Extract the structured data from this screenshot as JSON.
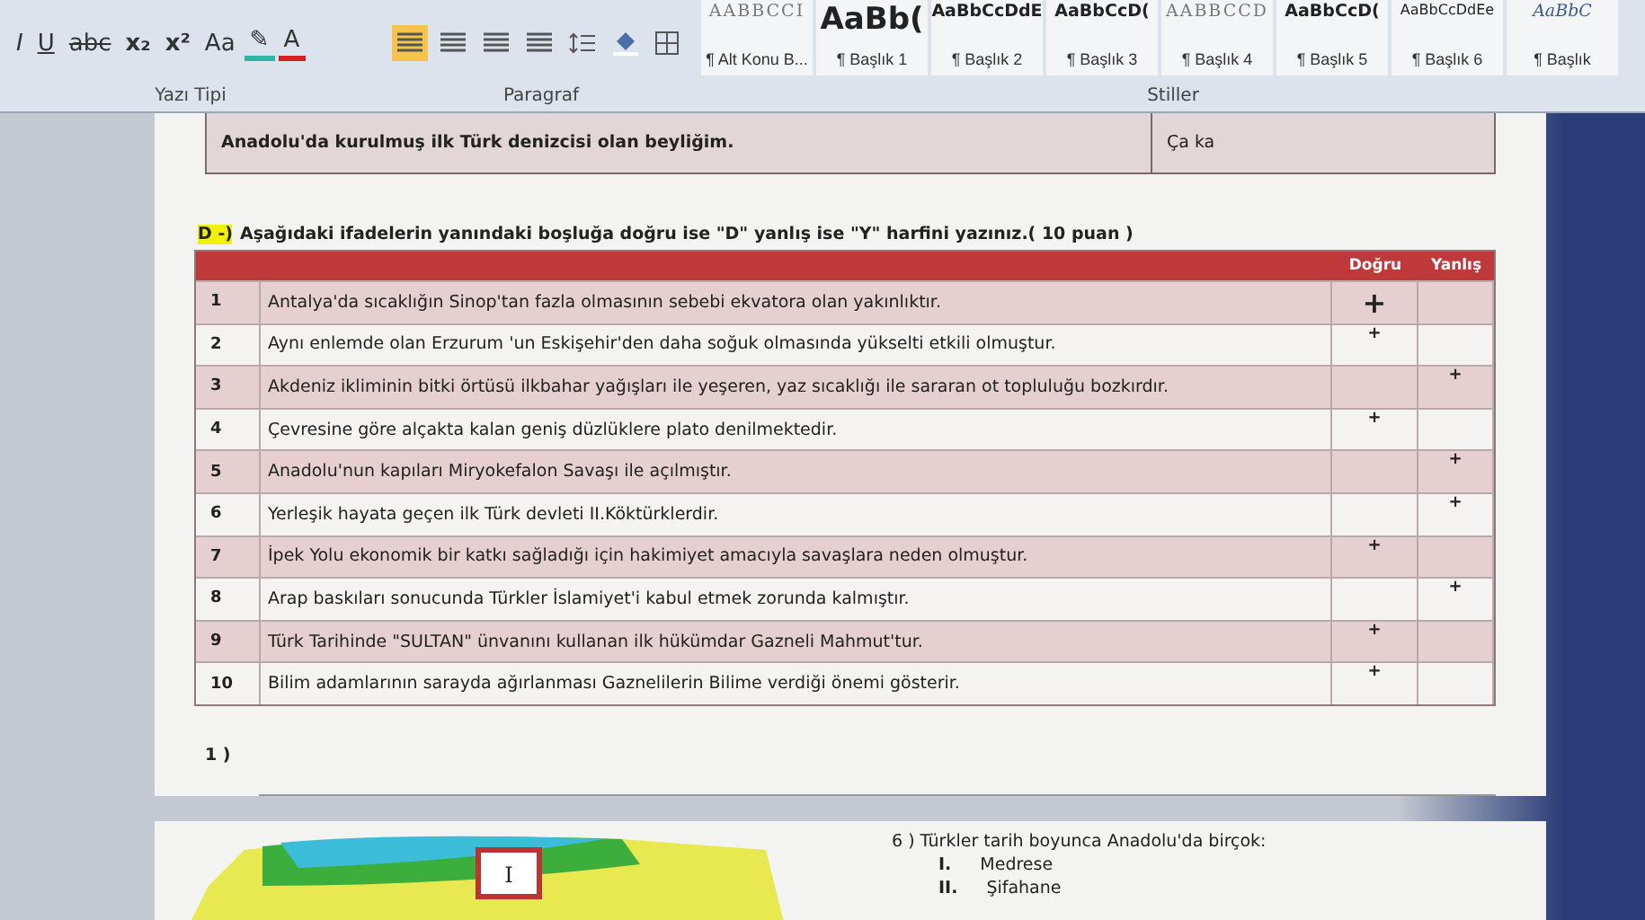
{
  "ribbon": {
    "format_buttons": [
      {
        "kind": "italic",
        "label": "I"
      },
      {
        "kind": "underline",
        "label": "U"
      },
      {
        "kind": "strike",
        "label": "abc"
      },
      {
        "kind": "sub",
        "label": "x₂"
      },
      {
        "kind": "sup",
        "label": "x²"
      },
      {
        "kind": "case",
        "label": "Aa"
      },
      {
        "kind": "highlight",
        "label": "✎"
      },
      {
        "kind": "fontcolor",
        "label": "A"
      }
    ],
    "styles": [
      {
        "preview": "AABBCCI",
        "label": "¶ Alt Konu B...",
        "kind": "spaced"
      },
      {
        "preview": "AaBb(",
        "label": "¶ Başlık 1",
        "kind": "big"
      },
      {
        "preview": "AaBbCcDdE",
        "label": "¶ Başlık 2",
        "kind": "bold"
      },
      {
        "preview": "AaBbCcD(",
        "label": "¶ Başlık 3",
        "kind": "bold"
      },
      {
        "preview": "AABBCCD",
        "label": "¶ Başlık 4",
        "kind": "spaced"
      },
      {
        "preview": "AaBbCcD(",
        "label": "¶ Başlık 5",
        "kind": "bold"
      },
      {
        "preview": "AaBbCcDdEe",
        "label": "¶ Başlık 6",
        "kind": "light"
      },
      {
        "preview": "AaBbC",
        "label": "¶ Başlık",
        "kind": "italic"
      }
    ],
    "groups": [
      "Yazı Tipi",
      "Paragraf",
      "Stiller"
    ]
  },
  "top_row": {
    "question": "Anadolu'da kurulmuş ilk Türk denizcisi olan beyliğim.",
    "answer": "Ça ka"
  },
  "section": {
    "tag": "D -)",
    "instruction": "Aşağıdaki ifadelerin yanındaki boşluğa doğru ise \"D\" yanlış ise \"Y\" harfini yazınız.( 10 puan )"
  },
  "table": {
    "columns": [
      "Doğru",
      "Yanlış"
    ],
    "rows": [
      {
        "number": "1",
        "text": "Antalya'da sıcaklığın Sinop'tan fazla olmasının sebebi ekvatora olan yakınlıktır.",
        "correct": "+"
      },
      {
        "number": "2",
        "text": "Aynı enlemde olan Erzurum 'un Eskişehir'den daha soğuk olmasında yükselti etkili olmuştur.",
        "correct": "+"
      },
      {
        "number": "3",
        "text": "Akdeniz ikliminin bitki örtüsü ilkbahar yağışları ile yeşeren, yaz sıcaklığı ile sararan ot topluluğu bozkırdır.",
        "wrong": "+"
      },
      {
        "number": "4",
        "text": "Çevresine göre alçakta kalan geniş düzlüklere plato denilmektedir.",
        "correct": "+"
      },
      {
        "number": "5",
        "text": "Anadolu'nun kapıları Miryokefalon Savaşı ile açılmıştır.",
        "wrong": "+"
      },
      {
        "number": "6",
        "text": "Yerleşik hayata geçen ilk Türk devleti II.Köktürklerdir.",
        "wrong": "+"
      },
      {
        "number": "7",
        "text": "İpek Yolu ekonomik bir katkı sağladığı için hakimiyet amacıyla savaşlara neden olmuştur.",
        "correct": "+"
      },
      {
        "number": "8",
        "text": "Arap baskıları sonucunda Türkler İslamiyet'i kabul etmek zorunda kalmıştır.",
        "wrong": "+"
      },
      {
        "number": "9",
        "text": "Türk Tarihinde \"SULTAN\" ünvanını kullanan ilk hükümdar Gazneli Mahmut'tur.",
        "correct": "+"
      },
      {
        "number": "10",
        "text": "Bilim adamlarının sarayda ağırlanması Gaznelilerin Bilime verdiği önemi gösterir.",
        "correct": "+"
      }
    ]
  },
  "question_1": {
    "label": "1 )"
  },
  "page_2": {
    "map_label": "I",
    "question": "6 ) Türkler tarih boyunca Anadolu'da birçok:",
    "items": [
      {
        "numeral": "I.",
        "text": "Medrese"
      },
      {
        "numeral": "II.",
        "text": "Şifahane"
      }
    ]
  }
}
